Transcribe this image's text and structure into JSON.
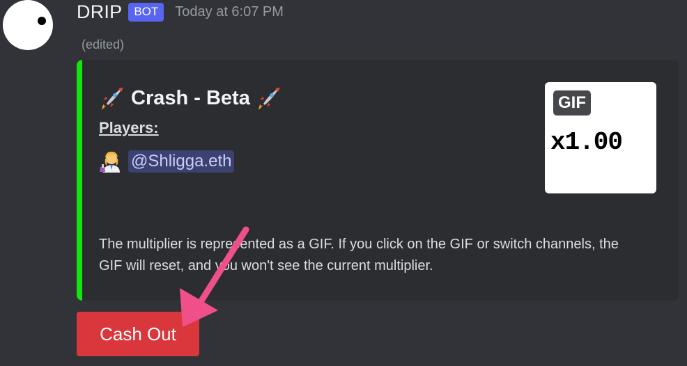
{
  "message": {
    "username": "DRIP",
    "bot_tag": "BOT",
    "timestamp": "Today at 6:07 PM",
    "edited_label": "(edited)"
  },
  "embed": {
    "accent_color": "#12e60e",
    "title": "Crash - Beta",
    "title_icon": "rocket-icon",
    "players_label": "Players:",
    "players": [
      {
        "icon": "scientist-emoji",
        "mention": "@Shligga.eth"
      }
    ],
    "description": "The multiplier is represented as a GIF. If you click on the GIF or switch channels, the GIF will reset, and you won't see the current multiplier.",
    "thumbnail": {
      "badge": "GIF",
      "value": "x1.00"
    }
  },
  "buttons": {
    "cash_out_label": "Cash Out",
    "cash_out_color": "#da373c"
  },
  "annotation": {
    "arrow_color": "#f0508a"
  }
}
